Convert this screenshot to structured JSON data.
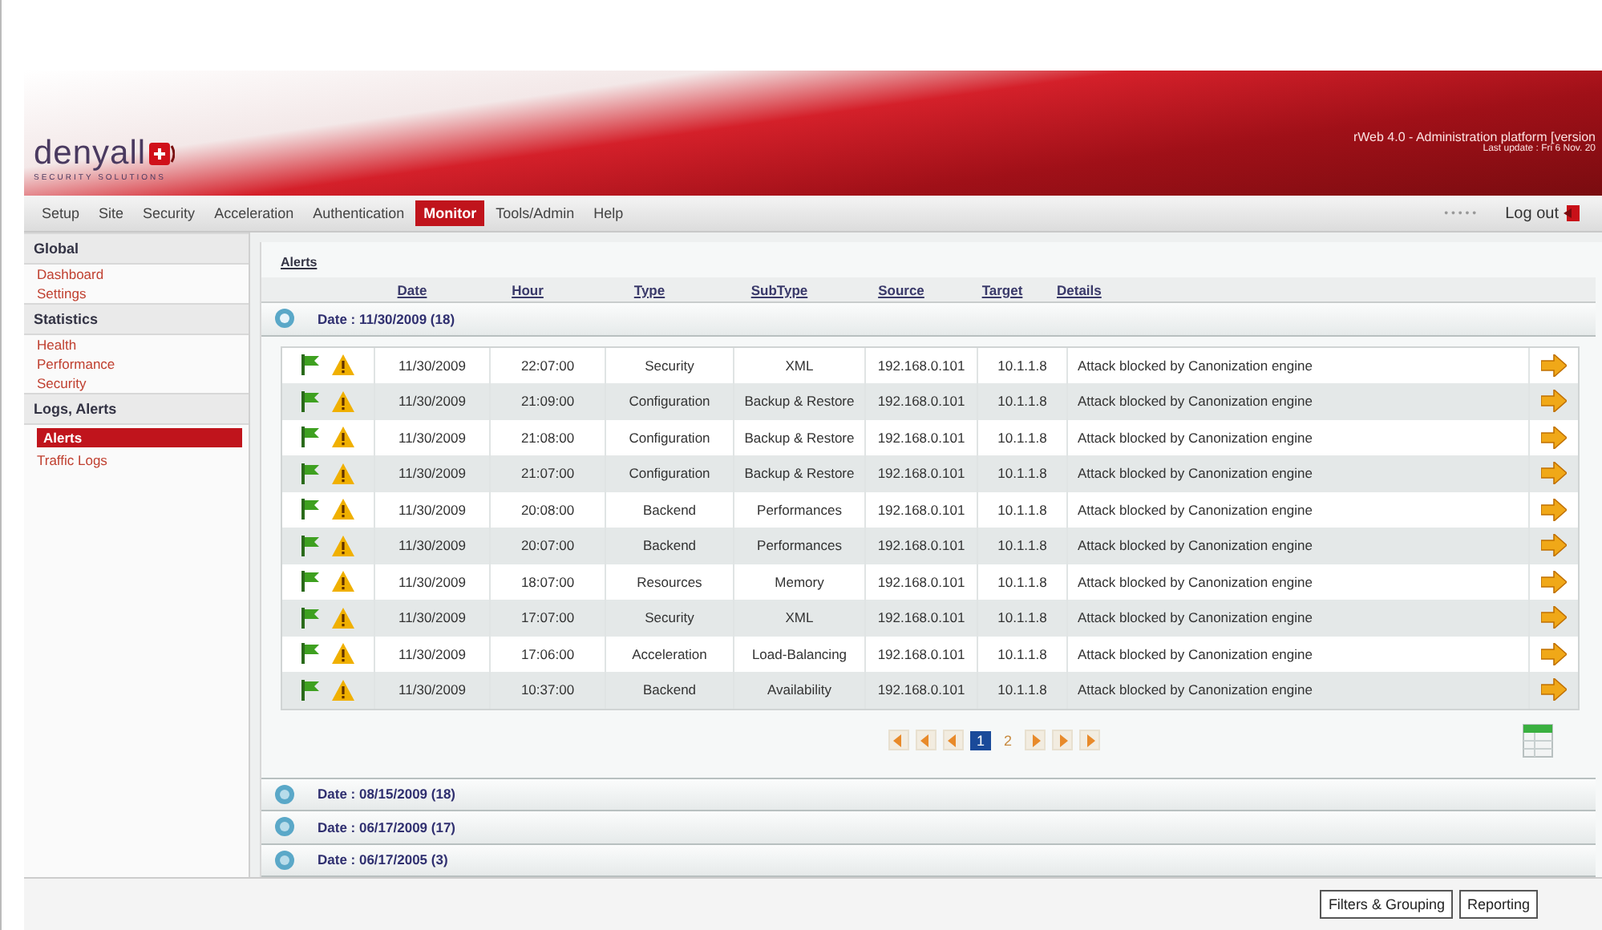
{
  "header": {
    "logo": "denyall",
    "tagline": "SECURITY SOLUTIONS",
    "title": "rWeb 4.0 - Administration platform [version",
    "subtitle": "Last update : Fri 6 Nov. 20"
  },
  "menu": [
    {
      "label": "Setup",
      "selected": false
    },
    {
      "label": "Site",
      "selected": false
    },
    {
      "label": "Security",
      "selected": false
    },
    {
      "label": "Acceleration",
      "selected": false
    },
    {
      "label": "Authentication",
      "selected": false
    },
    {
      "label": "Monitor",
      "selected": true
    },
    {
      "label": "Tools/Admin",
      "selected": false
    },
    {
      "label": "Help",
      "selected": false
    }
  ],
  "status_dots": "• • • • •",
  "logout": "Log out",
  "sidebar": [
    {
      "title": "Global",
      "items": [
        {
          "label": "Dashboard",
          "selected": false
        },
        {
          "label": "Settings",
          "selected": false
        }
      ]
    },
    {
      "title": "Statistics",
      "items": [
        {
          "label": "Health",
          "selected": false
        },
        {
          "label": "Performance",
          "selected": false
        },
        {
          "label": "Security",
          "selected": false
        }
      ]
    },
    {
      "title": "Logs, Alerts",
      "items": [
        {
          "label": "Alerts",
          "selected": true
        },
        {
          "label": "Traffic Logs",
          "selected": false
        }
      ]
    }
  ],
  "breadcrumb": "Alerts",
  "columns": [
    "Date",
    "Hour",
    "Type",
    "SubType",
    "Source",
    "Target",
    "Details"
  ],
  "groups": [
    {
      "label": "Date : 11/30/2009 (18)",
      "expanded": true,
      "rows": [
        {
          "date": "11/30/2009",
          "hour": "22:07:00",
          "type": "Security",
          "subtype": "XML",
          "source": "192.168.0.101",
          "target": "10.1.1.8",
          "details": "Attack blocked by Canonization engine"
        },
        {
          "date": "11/30/2009",
          "hour": "21:09:00",
          "type": "Configuration",
          "subtype": "Backup & Restore",
          "source": "192.168.0.101",
          "target": "10.1.1.8",
          "details": "Attack blocked by Canonization engine"
        },
        {
          "date": "11/30/2009",
          "hour": "21:08:00",
          "type": "Configuration",
          "subtype": "Backup & Restore",
          "source": "192.168.0.101",
          "target": "10.1.1.8",
          "details": "Attack blocked by Canonization engine"
        },
        {
          "date": "11/30/2009",
          "hour": "21:07:00",
          "type": "Configuration",
          "subtype": "Backup & Restore",
          "source": "192.168.0.101",
          "target": "10.1.1.8",
          "details": "Attack blocked by Canonization engine"
        },
        {
          "date": "11/30/2009",
          "hour": "20:08:00",
          "type": "Backend",
          "subtype": "Performances",
          "source": "192.168.0.101",
          "target": "10.1.1.8",
          "details": "Attack blocked by Canonization engine"
        },
        {
          "date": "11/30/2009",
          "hour": "20:07:00",
          "type": "Backend",
          "subtype": "Performances",
          "source": "192.168.0.101",
          "target": "10.1.1.8",
          "details": "Attack blocked by Canonization engine"
        },
        {
          "date": "11/30/2009",
          "hour": "18:07:00",
          "type": "Resources",
          "subtype": "Memory",
          "source": "192.168.0.101",
          "target": "10.1.1.8",
          "details": "Attack blocked by Canonization engine"
        },
        {
          "date": "11/30/2009",
          "hour": "17:07:00",
          "type": "Security",
          "subtype": "XML",
          "source": "192.168.0.101",
          "target": "10.1.1.8",
          "details": "Attack blocked by Canonization engine"
        },
        {
          "date": "11/30/2009",
          "hour": "17:06:00",
          "type": "Acceleration",
          "subtype": "Load-Balancing",
          "source": "192.168.0.101",
          "target": "10.1.1.8",
          "details": "Attack blocked by Canonization engine"
        },
        {
          "date": "11/30/2009",
          "hour": "10:37:00",
          "type": "Backend",
          "subtype": "Availability",
          "source": "192.168.0.101",
          "target": "10.1.1.8",
          "details": "Attack blocked by Canonization engine"
        }
      ]
    },
    {
      "label": "Date : 08/15/2009 (18)",
      "expanded": false
    },
    {
      "label": "Date : 06/17/2009 (17)",
      "expanded": false
    },
    {
      "label": "Date : 06/17/2005 (3)",
      "expanded": false
    }
  ],
  "pagination": {
    "pages": [
      {
        "label": "1",
        "selected": true
      },
      {
        "label": "2",
        "selected": false
      }
    ]
  },
  "buttons": [
    "Filters & Grouping",
    "Reporting"
  ]
}
